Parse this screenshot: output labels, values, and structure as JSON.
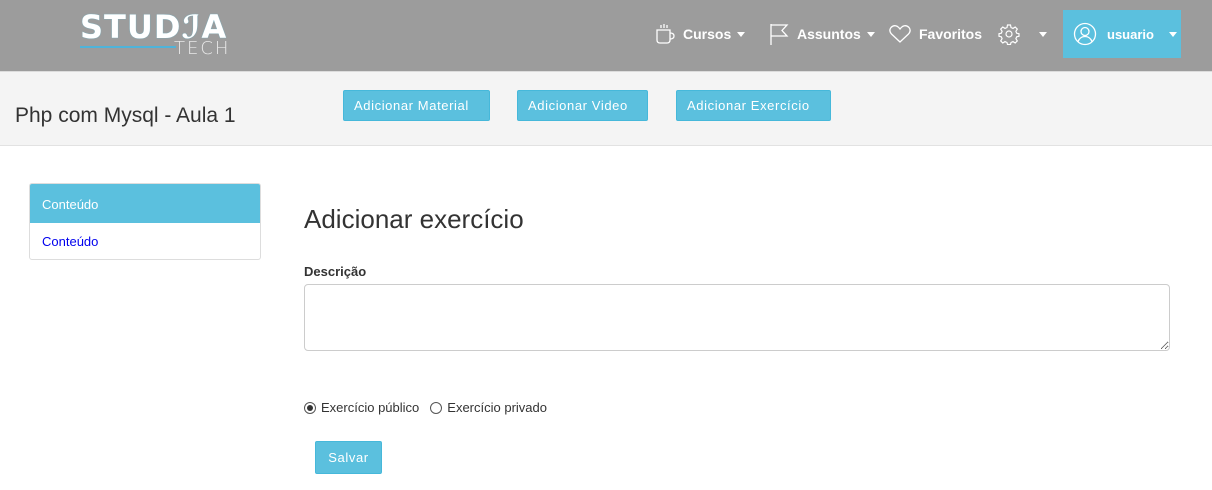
{
  "brand": {
    "main": "STUD",
    "accent": "ℐA",
    "sub": "TECH"
  },
  "nav": {
    "cursos": "Cursos",
    "assuntos": "Assuntos",
    "favoritos": "Favoritos",
    "user": "usuario"
  },
  "icons": {
    "cursos": "coffee-cup-icon",
    "assuntos": "flag-icon",
    "favoritos": "heart-icon",
    "settings": "gear-icon",
    "user": "user-circle-icon"
  },
  "header": {
    "course_title": "Php com Mysql - Aula 1",
    "buttons": {
      "material": "Adicionar Material",
      "video": "Adicionar Video",
      "exercicio": "Adicionar Exercício"
    }
  },
  "sidebar": {
    "heading": "Conteúdo",
    "items": [
      {
        "label": "Conteúdo"
      }
    ]
  },
  "form": {
    "title": "Adicionar exercício",
    "description_label": "Descrição",
    "description_value": "",
    "visibility": {
      "options": [
        {
          "label": "Exercício público",
          "checked": true
        },
        {
          "label": "Exercício privado",
          "checked": false
        }
      ]
    },
    "submit_label": "Salvar"
  },
  "colors": {
    "navbar": "#9c9c9c",
    "accent": "#5bc0de",
    "title_bar": "#f4f4f4",
    "link": "#0000ee"
  }
}
